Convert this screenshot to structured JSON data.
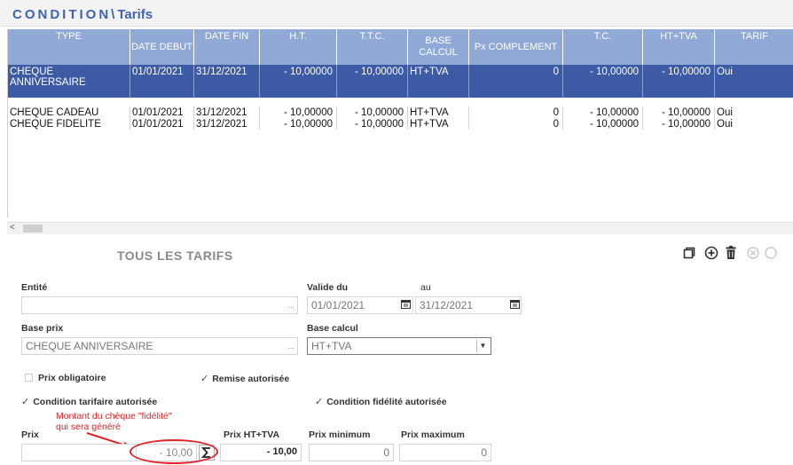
{
  "header": {
    "title_main": "CONDITION",
    "title_sep": "\\",
    "title_sub": "Tarifs"
  },
  "table": {
    "columns": [
      "TYPE",
      "DATE DEBUT",
      "DATE FIN",
      "H.T.",
      "T.T.C.",
      "BASE CALCUL",
      "Px COMPLEMENT",
      "T.C.",
      "HT+TVA",
      "TARIF"
    ],
    "rows": [
      {
        "type": "CHEQUE ANNIVERSAIRE",
        "date_debut": "01/01/2021",
        "date_fin": "31/12/2021",
        "ht": "- 10,00000",
        "ttc": "- 10,00000",
        "base_calcul": "HT+TVA",
        "px_complement": "0",
        "tc": "- 10,00000",
        "ht_tva": "- 10,00000",
        "tarif": "Oui"
      },
      {
        "type": "CHEQUE CADEAU",
        "date_debut": "01/01/2021",
        "date_fin": "31/12/2021",
        "ht": "- 10,00000",
        "ttc": "- 10,00000",
        "base_calcul": "HT+TVA",
        "px_complement": "0",
        "tc": "- 10,00000",
        "ht_tva": "- 10,00000",
        "tarif": "Oui"
      },
      {
        "type": "CHEQUE FIDELITE",
        "date_debut": "01/01/2021",
        "date_fin": "31/12/2021",
        "ht": "- 10,00000",
        "ttc": "- 10,00000",
        "base_calcul": "HT+TVA",
        "px_complement": "0",
        "tc": "- 10,00000",
        "ht_tva": "- 10,00000",
        "tarif": "Oui"
      }
    ],
    "scroll_arrow": "<"
  },
  "form": {
    "section_title": "TOUS LES TARIFS",
    "toolbar": {
      "copy_icon": "copy-icon",
      "add_icon": "add-circle-icon",
      "delete_icon": "trash-icon",
      "disabled_icon": "close-circle-icon"
    },
    "entite": {
      "label": "Entité",
      "value": "",
      "browse": "..."
    },
    "valide_du": {
      "label": "Valide du",
      "value": "01/01/2021"
    },
    "au": {
      "label": "au",
      "value": "31/12/2021"
    },
    "base_prix": {
      "label": "Base prix",
      "value": "CHEQUE ANNIVERSAIRE",
      "browse": "..."
    },
    "base_calcul": {
      "label": "Base calcul",
      "value": "HT+TVA"
    },
    "prix_obligatoire": {
      "label": "Prix obligatoire",
      "checked": false
    },
    "remise_autorisee": {
      "label": "Remise autorisée",
      "checked": true
    },
    "condition_tarifaire": {
      "label": "Condition tarifaire autorisée",
      "checked": true
    },
    "condition_fidelite": {
      "label": "Condition fidélité autorisée",
      "checked": true
    },
    "prix": {
      "label": "Prix",
      "value": "",
      "value2": "- 10,00"
    },
    "prix_ht_tva": {
      "label": "Prix HT+TVA",
      "value": "- 10,00"
    },
    "prix_minimum": {
      "label": "Prix minimum",
      "value": "0"
    },
    "prix_maximum": {
      "label": "Prix maximum",
      "value": "0"
    },
    "annotation_line1": "Montant du chèque \"fidélité\"",
    "annotation_line2": "qui sera généré"
  },
  "colors": {
    "accent": "#3e63b5",
    "header_bg": "#90a9d6",
    "selected_row": "#3d5ba5",
    "annotation": "#e0242a"
  }
}
